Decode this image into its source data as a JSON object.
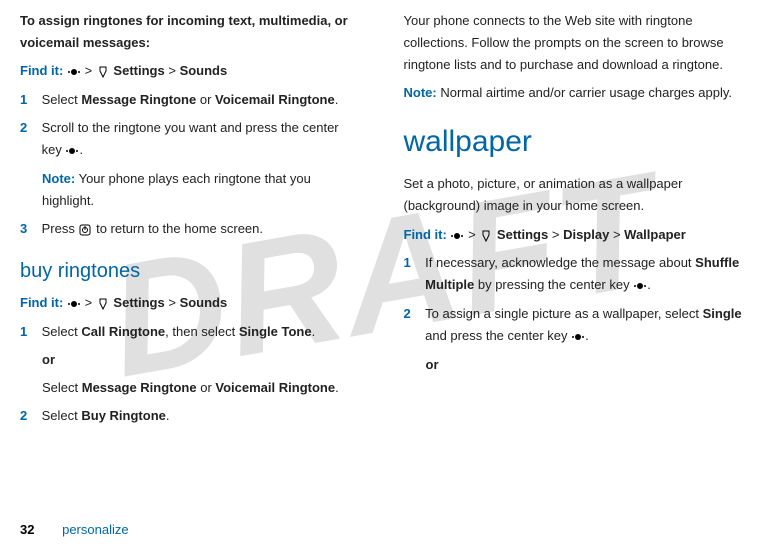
{
  "watermark": "DRAFT",
  "left": {
    "heading": "To assign ringtones for incoming text, multimedia, or voicemail messages:",
    "findit_label": "Find it:",
    "findit_path1": "Settings",
    "findit_path2": "Sounds",
    "step1_num": "1",
    "step1_a": "Select ",
    "step1_b": "Message Ringtone",
    "step1_c": " or ",
    "step1_d": "Voicemail Ringtone",
    "step1_e": ".",
    "step2_num": "2",
    "step2_a": "Scroll to the ringtone you want and press the center key ",
    "step2_b": ".",
    "note_label": "Note:",
    "note_text": " Your phone plays each ringtone that you highlight.",
    "step3_num": "3",
    "step3_a": "Press ",
    "step3_b": " to return to the home screen.",
    "buy_heading": "buy ringtones",
    "findit2_label": "Find it:",
    "findit2_path1": "Settings",
    "findit2_path2": "Sounds",
    "buy1_num": "1",
    "buy1_a": "Select ",
    "buy1_b": "Call Ringtone",
    "buy1_c": ", then select ",
    "buy1_d": "Single Tone",
    "buy1_e": ".",
    "buy_or": "or",
    "buy1_f": "Select ",
    "buy1_g": "Message Ringtone",
    "buy1_h": " or ",
    "buy1_i": "Voicemail Ringtone",
    "buy1_j": ".",
    "buy2_num": "2",
    "buy2_a": "Select ",
    "buy2_b": "Buy Ringtone",
    "buy2_c": "."
  },
  "right": {
    "p1": "Your phone connects to the Web site with ringtone collections. Follow the prompts on the screen to browse ringtone lists and to purchase and download a ringtone.",
    "note_label": "Note:",
    "note_text": " Normal airtime and/or carrier usage charges apply.",
    "wall_heading": "wallpaper",
    "wall_intro": "Set a photo, picture, or animation as a wallpaper (background) image in your home screen.",
    "findit3_label": "Find it:",
    "findit3_path1": "Settings",
    "findit3_path2": "Display",
    "findit3_path3": "Wallpaper",
    "w1_num": "1",
    "w1_a": "If necessary, acknowledge the message about ",
    "w1_b": "Shuffle Multiple",
    "w1_c": " by pressing the center key ",
    "w1_d": ".",
    "w2_num": "2",
    "w2_a": "To assign a single picture as a wallpaper, select ",
    "w2_b": "Single",
    "w2_c": " and press the center key ",
    "w2_d": ".",
    "w_or": "or"
  },
  "footer": {
    "page": "32",
    "label": "personalize"
  },
  "gt": ">"
}
